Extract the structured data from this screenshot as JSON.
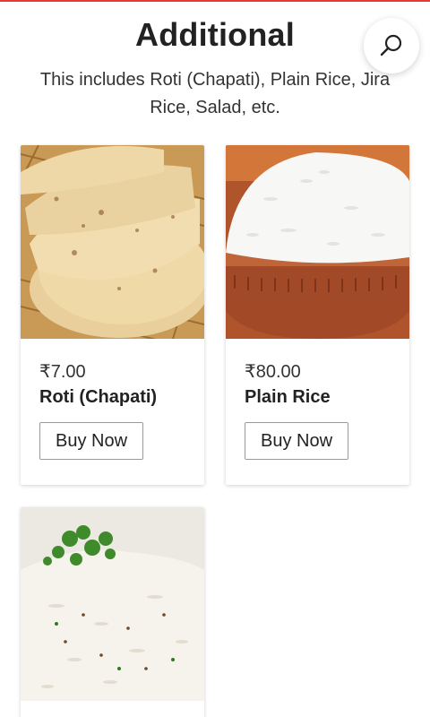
{
  "header": {
    "title": "Additional",
    "subtitle": "This includes Roti (Chapati), Plain Rice, Jira Rice, Salad, etc.",
    "search_icon": "search-icon"
  },
  "products": [
    {
      "price": "₹7.00",
      "name": "Roti (Chapati)",
      "button_label": "Buy Now"
    },
    {
      "price": "₹80.00",
      "name": "Plain Rice",
      "button_label": "Buy Now"
    },
    {
      "price": "",
      "name": "",
      "button_label": ""
    }
  ],
  "colors": {
    "accent": "#e53935",
    "text": "#222222",
    "border": "#9a9a9a"
  }
}
